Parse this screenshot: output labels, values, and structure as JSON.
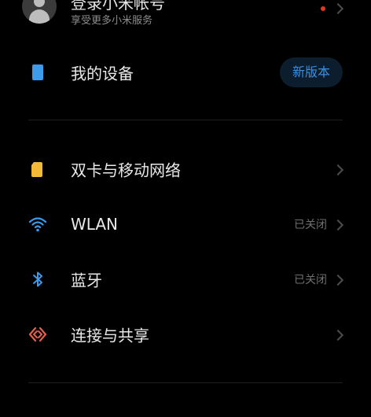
{
  "account": {
    "title": "登录小米帐号",
    "subtitle": "享受更多小米服务"
  },
  "items": [
    {
      "label": "我的设备",
      "badge": "新版本",
      "icon": "device-icon"
    },
    {
      "label": "双卡与移动网络",
      "icon": "sim-card-icon"
    },
    {
      "label": "WLAN",
      "status": "已关闭",
      "icon": "wifi-icon"
    },
    {
      "label": "蓝牙",
      "status": "已关闭",
      "icon": "bluetooth-icon"
    },
    {
      "label": "连接与共享",
      "icon": "connection-share-icon"
    }
  ],
  "colors": {
    "background": "#000000",
    "accent_blue": "#3a8fe0",
    "sim_yellow": "#f5b938",
    "share_orange": "#e5604f",
    "notification_red": "#e0391f"
  }
}
